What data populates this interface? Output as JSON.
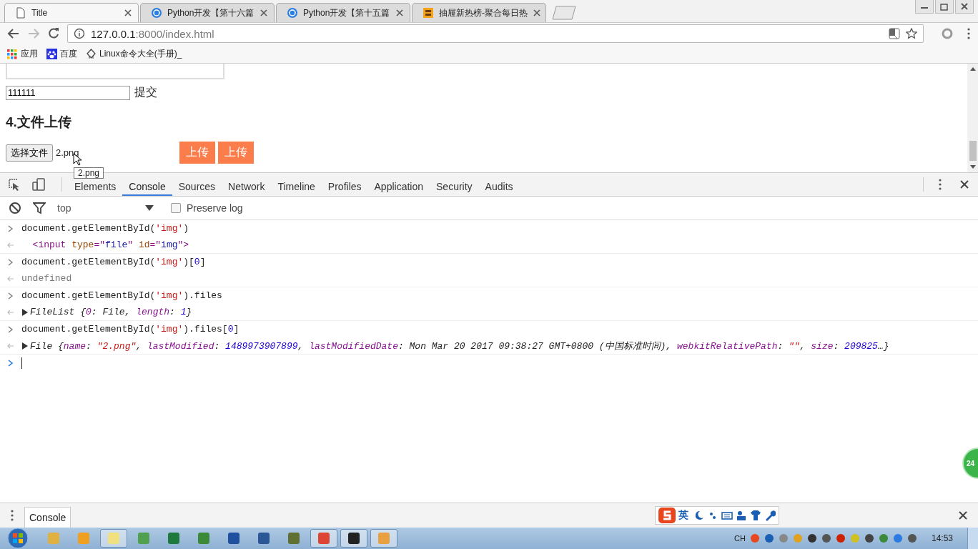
{
  "browser": {
    "tabs": [
      {
        "title": "Title",
        "selected": true
      },
      {
        "title": "Python开发【第十六篇",
        "selected": false
      },
      {
        "title": "Python开发【第十五篇",
        "selected": false
      },
      {
        "title": "抽屉新热榜-聚合每日热",
        "selected": false
      }
    ],
    "url_host": "127.0.0.1",
    "url_rest": ":8000/index.html",
    "bookmarks": [
      {
        "label": "应用"
      },
      {
        "label": "百度"
      },
      {
        "label": "Linux命令大全(手册)_"
      }
    ]
  },
  "page": {
    "text_value": "111111",
    "submit_label": "提交",
    "heading": "4.文件上传",
    "file_button": "选择文件",
    "file_name": "2.png",
    "upload_buttons": [
      "上传",
      "上传"
    ],
    "tooltip": "2.png"
  },
  "devtools": {
    "tabs": [
      {
        "label": "Elements",
        "selected": false
      },
      {
        "label": "Console",
        "selected": true
      },
      {
        "label": "Sources",
        "selected": false
      },
      {
        "label": "Network",
        "selected": false
      },
      {
        "label": "Timeline",
        "selected": false
      },
      {
        "label": "Profiles",
        "selected": false
      },
      {
        "label": "Application",
        "selected": false
      },
      {
        "label": "Security",
        "selected": false
      },
      {
        "label": "Audits",
        "selected": false
      }
    ],
    "context": "top",
    "preserve_log": {
      "label": "Preserve log",
      "checked": false
    },
    "console": [
      {
        "kind": "input",
        "segments": [
          {
            "kind": "code",
            "text": "document.getElementById("
          },
          {
            "kind": "str",
            "text": "'img'"
          },
          {
            "kind": "code",
            "text": ")"
          }
        ]
      },
      {
        "kind": "output",
        "segments": [
          {
            "kind": "tag",
            "text": "  <input "
          },
          {
            "kind": "attr",
            "text": "type"
          },
          {
            "kind": "tag",
            "text": "=\""
          },
          {
            "kind": "attrval",
            "text": "file"
          },
          {
            "kind": "tag",
            "text": "\" "
          },
          {
            "kind": "attr",
            "text": "id"
          },
          {
            "kind": "tag",
            "text": "=\""
          },
          {
            "kind": "attrval",
            "text": "img"
          },
          {
            "kind": "tag",
            "text": "\">"
          }
        ]
      },
      {
        "kind": "input",
        "segments": [
          {
            "kind": "code",
            "text": "document.getElementById("
          },
          {
            "kind": "str",
            "text": "'img'"
          },
          {
            "kind": "code",
            "text": ")["
          },
          {
            "kind": "num",
            "text": "0"
          },
          {
            "kind": "code",
            "text": "]"
          }
        ]
      },
      {
        "kind": "output",
        "segments": [
          {
            "kind": "dim",
            "text": "undefined"
          }
        ]
      },
      {
        "kind": "input",
        "segments": [
          {
            "kind": "code",
            "text": "document.getElementById("
          },
          {
            "kind": "str",
            "text": "'img'"
          },
          {
            "kind": "code",
            "text": ").files"
          }
        ]
      },
      {
        "kind": "output",
        "expanded": false,
        "segments": [
          {
            "kind": "obj",
            "text": "FileList {"
          },
          {
            "kind": "key",
            "text": "0"
          },
          {
            "kind": "obj",
            "text": ": File, "
          },
          {
            "kind": "key",
            "text": "length"
          },
          {
            "kind": "obj",
            "text": ": "
          },
          {
            "kind": "num",
            "text": "1"
          },
          {
            "kind": "obj",
            "text": "}"
          }
        ]
      },
      {
        "kind": "input",
        "segments": [
          {
            "kind": "code",
            "text": "document.getElementById("
          },
          {
            "kind": "str",
            "text": "'img'"
          },
          {
            "kind": "code",
            "text": ").files["
          },
          {
            "kind": "num",
            "text": "0"
          },
          {
            "kind": "code",
            "text": "]"
          }
        ]
      },
      {
        "kind": "output",
        "expanded": false,
        "segments": [
          {
            "kind": "obj",
            "text": "File {"
          },
          {
            "kind": "key",
            "text": "name"
          },
          {
            "kind": "obj",
            "text": ": "
          },
          {
            "kind": "str",
            "text": "\"2.png\""
          },
          {
            "kind": "obj",
            "text": ", "
          },
          {
            "kind": "key",
            "text": "lastModified"
          },
          {
            "kind": "obj",
            "text": ": "
          },
          {
            "kind": "num",
            "text": "1489973907899"
          },
          {
            "kind": "obj",
            "text": ", "
          },
          {
            "kind": "key",
            "text": "lastModifiedDate"
          },
          {
            "kind": "obj",
            "text": ": Mon Mar 20 2017 09:38:27 GMT+0800 (中国标准时间), "
          },
          {
            "kind": "key",
            "text": "webkitRelativePath"
          },
          {
            "kind": "obj",
            "text": ": "
          },
          {
            "kind": "str",
            "text": "\"\""
          },
          {
            "kind": "obj",
            "text": ", "
          },
          {
            "kind": "key",
            "text": "size"
          },
          {
            "kind": "obj",
            "text": ": "
          },
          {
            "kind": "num",
            "text": "209825"
          },
          {
            "kind": "obj",
            "text": "…}"
          }
        ]
      },
      {
        "kind": "prompt"
      }
    ],
    "floating_badge": "24",
    "drawer_tab": "Console"
  },
  "ime": {
    "mode": "英"
  },
  "taskbar": {
    "apps": [
      {
        "color": "#e0b040",
        "selected": false
      },
      {
        "color": "#f0a020",
        "selected": false
      },
      {
        "color": "#f0e080",
        "selected": true
      },
      {
        "color": "#50a050",
        "selected": false
      },
      {
        "color": "#1e7a3c",
        "selected": false
      },
      {
        "color": "#3a8a3a",
        "selected": false
      },
      {
        "color": "#2050a0",
        "selected": false
      },
      {
        "color": "#2b5797",
        "selected": false
      },
      {
        "color": "#607030",
        "selected": false
      },
      {
        "color": "#dd4433",
        "selected": true
      },
      {
        "color": "#222222",
        "selected": true
      },
      {
        "color": "#e8a040",
        "selected": true
      }
    ],
    "lang": "CH",
    "clock": "14:53"
  }
}
